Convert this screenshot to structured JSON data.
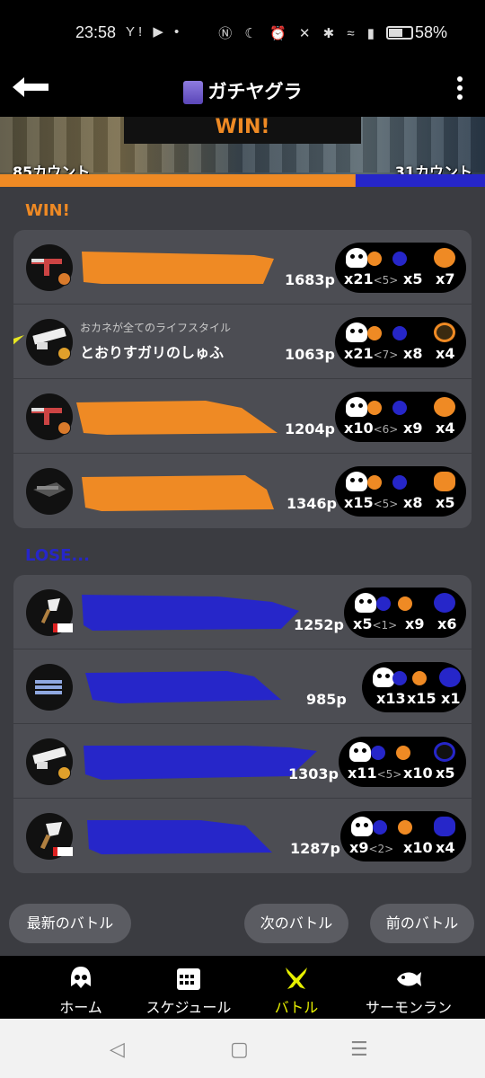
{
  "status_bar": {
    "time": "23:58",
    "battery": "58%",
    "left_icons": "Y! ▶ •",
    "right_icons": "Ⓝ ☾ ⏰ ✕ ✱ ≈ ▮"
  },
  "header": {
    "title": "ガチヤグラ",
    "back_icon": "back-arrow-icon",
    "menu_icon": "kebab-menu-icon"
  },
  "banner": {
    "result": "WIN!",
    "left_count": "85カウント",
    "right_count": "31カウント",
    "win_fraction": 0.733
  },
  "colors": {
    "alpha": "#ef8a24",
    "bravo": "#2626c9",
    "card": "#4c4d53",
    "bg": "#3b3c41"
  },
  "win_label": "WIN!",
  "lose_label": "LOSE...",
  "alpha_team": [
    {
      "weapon_icon": "splattershot-jr-icon",
      "sub": "",
      "name": "",
      "points": "1683p",
      "kills": "x21",
      "assist": "<5>",
      "deaths": "x5",
      "specials": "x7"
    },
    {
      "weapon_icon": "splatana-icon",
      "sub": "おカネが全てのライフスタイル",
      "name": "とおりすガリのしゅふ",
      "points": "1063p",
      "kills": "x21",
      "assist": "<7>",
      "deaths": "x8",
      "specials": "x4"
    },
    {
      "weapon_icon": "splattershot-jr-icon",
      "sub": "",
      "name": "",
      "points": "1204p",
      "kills": "x10",
      "assist": "<6>",
      "deaths": "x9",
      "specials": "x4"
    },
    {
      "weapon_icon": "splatana-stamper-icon",
      "sub": "",
      "name": "",
      "points": "1346p",
      "kills": "x15",
      "assist": "<5>",
      "deaths": "x8",
      "specials": "x5"
    }
  ],
  "bravo_team": [
    {
      "weapon_icon": "inkbrush-icon",
      "points": "1252p",
      "kills": "x5",
      "assist": "<1>",
      "deaths": "x9",
      "specials": "x6"
    },
    {
      "weapon_icon": "tri-stringer-icon",
      "points": "985p",
      "kills": "x13",
      "assist": "",
      "deaths": "x15",
      "specials": "x1"
    },
    {
      "weapon_icon": "splatana-icon",
      "points": "1303p",
      "kills": "x11",
      "assist": "<5>",
      "deaths": "x10",
      "specials": "x5"
    },
    {
      "weapon_icon": "octobrush-icon",
      "points": "1287p",
      "kills": "x9",
      "assist": "<2>",
      "deaths": "x10",
      "specials": "x4"
    }
  ],
  "nav_buttons": {
    "latest": "最新のバトル",
    "next": "次のバトル",
    "prev": "前のバトル"
  },
  "bottom_nav": [
    {
      "label": "ホーム",
      "icon": "squid-home-icon"
    },
    {
      "label": "スケジュール",
      "icon": "calendar-icon"
    },
    {
      "label": "バトル",
      "icon": "battle-icon"
    },
    {
      "label": "サーモンラン",
      "icon": "salmon-icon"
    }
  ],
  "system_nav": {
    "back": "◁",
    "home": "▢",
    "recents": "☰"
  }
}
